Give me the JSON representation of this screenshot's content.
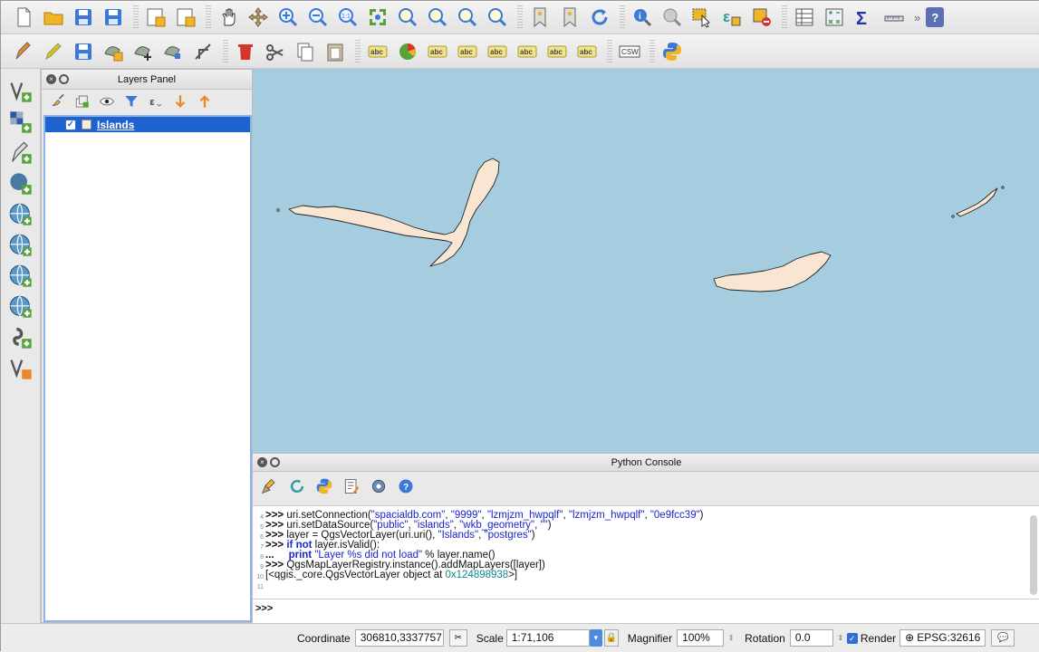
{
  "toolbar1": {
    "icons": [
      "new-project-icon",
      "open-project-icon",
      "save-project-icon",
      "save-as-icon",
      "new-print-composer-icon",
      "composer-manager-icon",
      "pan-icon",
      "pan-to-selection-icon",
      "zoom-in-icon",
      "zoom-out-icon",
      "zoom-actual-icon",
      "zoom-full-icon",
      "zoom-to-selection-icon",
      "zoom-to-layer-icon",
      "zoom-last-icon",
      "zoom-next-icon",
      "new-bookmark-icon",
      "show-bookmarks-icon",
      "refresh-icon",
      "identify-icon",
      "run-action-icon",
      "select-features-icon",
      "select-by-expression-icon",
      "deselect-icon",
      "attribute-table-icon",
      "field-calculator-icon",
      "statistics-icon",
      "measure-icon"
    ],
    "help_label": "?",
    "more_label": "»"
  },
  "toolbar2": {
    "icons": [
      "current-edits-icon",
      "toggle-editing-icon",
      "save-edits-icon",
      "add-feature-icon",
      "move-feature-icon",
      "node-tool-icon",
      "split-parts-icon",
      "delete-selected-icon",
      "cut-features-icon",
      "copy-features-icon",
      "paste-features-icon",
      "label-toolbar-icon",
      "diagram-icon",
      "layer-labeling-icon",
      "pin-labels-icon",
      "show-hide-labels-icon",
      "move-label-icon",
      "rotate-label-icon",
      "change-label-icon",
      "csw-icon",
      "python-icon"
    ],
    "label_abc": "abc",
    "csw_label": "CSW"
  },
  "vertical_toolbar": [
    "add-vector-layer-icon",
    "add-raster-layer-icon",
    "add-delimited-text-icon",
    "add-postgis-layer-icon",
    "add-spatialite-layer-icon",
    "add-wms-layer-icon",
    "add-wfs-layer-icon",
    "add-oracle-layer-icon",
    "new-shapefile-icon",
    "new-spatialite-icon"
  ],
  "layers_panel": {
    "title": "Layers Panel",
    "tools": [
      "style-icon",
      "add-group-icon",
      "manage-visibility-icon",
      "filter-legend-icon",
      "filter-expression-icon",
      "expand-all-icon",
      "collapse-all-icon"
    ],
    "layers": [
      {
        "name": "Islands",
        "visible": true
      }
    ]
  },
  "map": {
    "background_color": "#a6cddf",
    "feature_fill": "#f8e5d2",
    "feature_stroke": "#222222"
  },
  "python_console": {
    "title": "Python Console",
    "tools": [
      "clear-console-icon",
      "run-command-icon",
      "show-editor-icon",
      "open-script-icon",
      "settings-icon",
      "help-icon"
    ],
    "lines": [
      {
        "no": "4",
        "prompt": ">>> ",
        "segments": [
          {
            "t": "uri.setConnection(",
            "c": ""
          },
          {
            "t": "\"spacialdb.com\"",
            "c": "str"
          },
          {
            "t": ", ",
            "c": ""
          },
          {
            "t": "\"9999\"",
            "c": "str"
          },
          {
            "t": ", ",
            "c": ""
          },
          {
            "t": "\"lzmjzm_hwpqlf\"",
            "c": "str"
          },
          {
            "t": ", ",
            "c": ""
          },
          {
            "t": "\"lzmjzm_hwpqlf\"",
            "c": "str"
          },
          {
            "t": ", ",
            "c": ""
          },
          {
            "t": "\"0e9fcc39\"",
            "c": "str"
          },
          {
            "t": ")",
            "c": ""
          }
        ]
      },
      {
        "no": "5",
        "prompt": ">>> ",
        "segments": [
          {
            "t": "uri.setDataSource(",
            "c": ""
          },
          {
            "t": "\"public\"",
            "c": "str"
          },
          {
            "t": ", ",
            "c": ""
          },
          {
            "t": "\"islands\"",
            "c": "str"
          },
          {
            "t": ", ",
            "c": ""
          },
          {
            "t": "\"wkb_geometry\"",
            "c": "str"
          },
          {
            "t": ", ",
            "c": ""
          },
          {
            "t": "\"\"",
            "c": "str"
          },
          {
            "t": ")",
            "c": ""
          }
        ]
      },
      {
        "no": "6",
        "prompt": ">>> ",
        "segments": [
          {
            "t": "layer = QgsVectorLayer(uri.uri(), ",
            "c": ""
          },
          {
            "t": "\"Islands\"",
            "c": "str"
          },
          {
            "t": ", ",
            "c": ""
          },
          {
            "t": "\"postgres\"",
            "c": "str"
          },
          {
            "t": ")",
            "c": ""
          }
        ]
      },
      {
        "no": "7",
        "prompt": ">>> ",
        "segments": [
          {
            "t": "if not",
            "c": "kw"
          },
          {
            "t": " layer.isValid():",
            "c": ""
          }
        ]
      },
      {
        "no": "8",
        "prompt": "...  ",
        "segments": [
          {
            "t": "   print",
            "c": "kw"
          },
          {
            "t": " ",
            "c": ""
          },
          {
            "t": "\"Layer %s did not load\"",
            "c": "str"
          },
          {
            "t": " % layer.name()",
            "c": ""
          }
        ]
      },
      {
        "no": "9",
        "prompt": ">>> ",
        "segments": [
          {
            "t": "QgsMapLayerRegistry.instance().addMapLayers([layer])",
            "c": ""
          }
        ]
      },
      {
        "no": "10",
        "prompt": "",
        "segments": [
          {
            "t": "[<qgis._core.QgsVectorLayer object at ",
            "c": ""
          },
          {
            "t": "0x124898938",
            "c": "num"
          },
          {
            "t": ">]",
            "c": ""
          }
        ]
      },
      {
        "no": "11",
        "prompt": "",
        "segments": []
      }
    ],
    "input_prompt": ">>>"
  },
  "status_bar": {
    "coordinate_label": "Coordinate",
    "coordinate_value": "306810,3337757",
    "scale_label": "Scale",
    "scale_value": "1:71,106",
    "magnifier_label": "Magnifier",
    "magnifier_value": "100%",
    "rotation_label": "Rotation",
    "rotation_value": "0.0",
    "render_label": "Render",
    "render_checked": true,
    "crs_label": "EPSG:32616"
  }
}
